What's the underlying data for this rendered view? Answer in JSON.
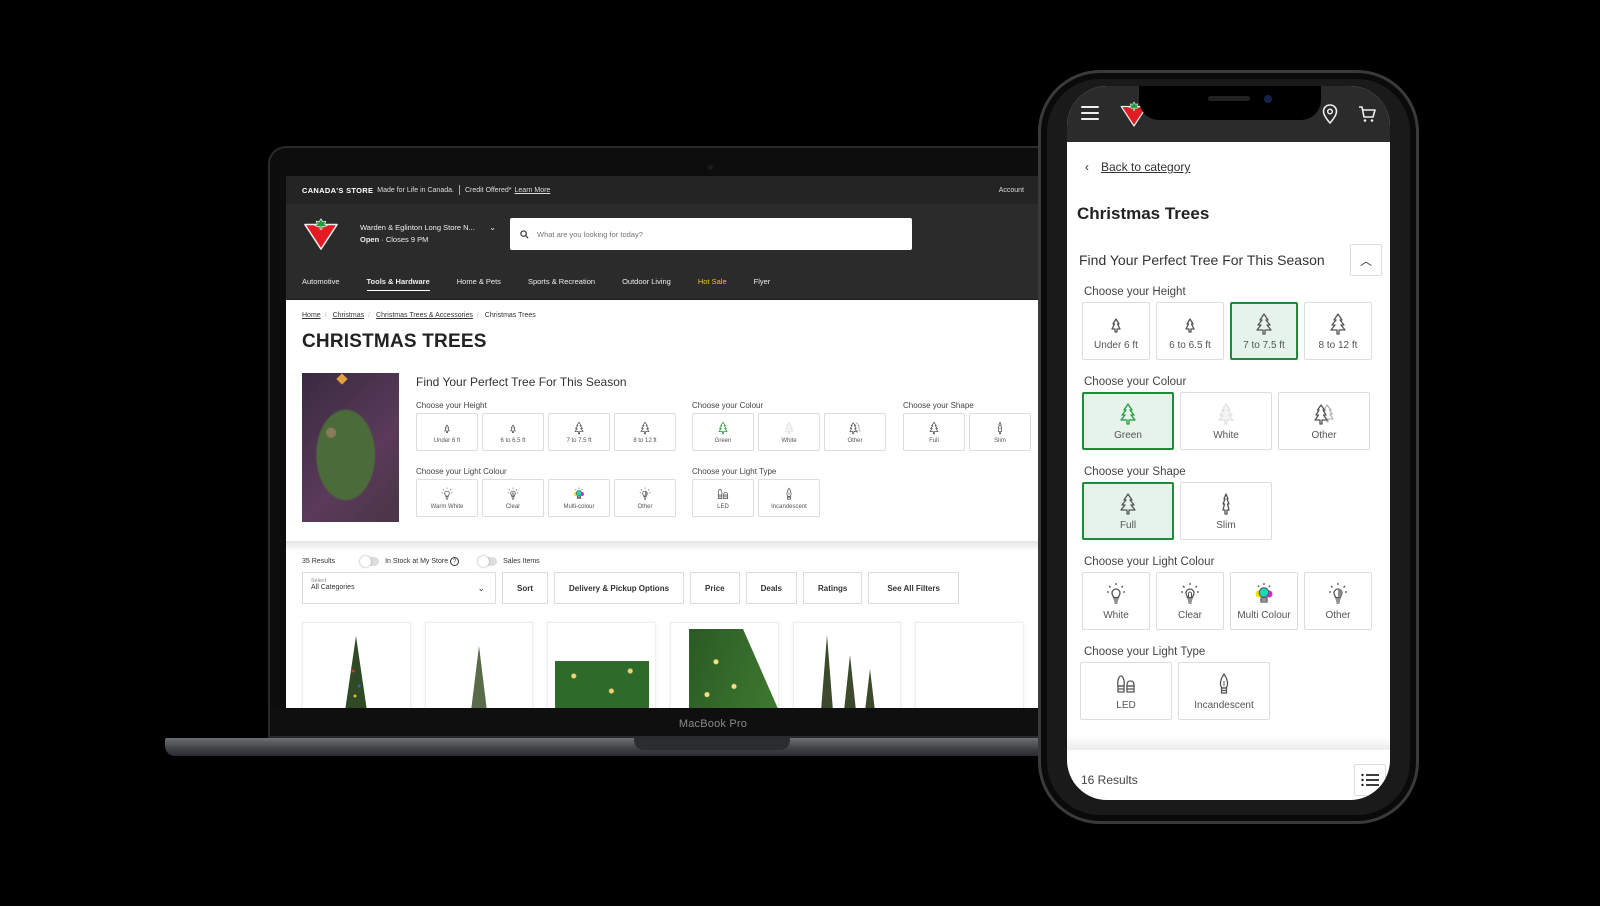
{
  "laptop": {
    "brand_label": "MacBook Pro",
    "utility_bar": {
      "brand": "CANADA'S STORE",
      "tagline": "Made for Life in Canada.",
      "credit": "Credit Offered*",
      "learn_more": "Learn More",
      "account": "Account"
    },
    "header": {
      "store_name": "Warden & Eglinton Long Store N...",
      "store_status": "Open",
      "store_hours": "· Closes 9 PM",
      "search_placeholder": "What are you looking for today?"
    },
    "nav": [
      {
        "label": "Automotive"
      },
      {
        "label": "Tools & Hardware",
        "active": true
      },
      {
        "label": "Home & Pets"
      },
      {
        "label": "Sports & Recreation"
      },
      {
        "label": "Outdoor Living"
      },
      {
        "label": "Hot Sale",
        "highlight": true
      },
      {
        "label": "Flyer"
      }
    ],
    "breadcrumb": [
      "Home",
      "Christmas",
      "Christmas Trees & Accessories",
      "Christmas Trees"
    ],
    "page_title": "CHRISTMAS TREES",
    "finder": {
      "title": "Find Your Perfect Tree For This Season",
      "height": {
        "label": "Choose your Height",
        "options": [
          "Under 6 ft",
          "6 to 6.5 ft",
          "7 to 7.5 ft",
          "8 to 12 ft"
        ]
      },
      "colour": {
        "label": "Choose your Colour",
        "options": [
          "Green",
          "White",
          "Other"
        ]
      },
      "shape": {
        "label": "Choose your Shape",
        "options": [
          "Full",
          "Slim"
        ]
      },
      "light_colour": {
        "label": "Choose your Light Colour",
        "options": [
          "Warm White",
          "Clear",
          "Multi-colour",
          "Other"
        ]
      },
      "light_type": {
        "label": "Choose your Light Type",
        "options": [
          "LED",
          "Incandescent"
        ]
      }
    },
    "results": {
      "count": "35 Results",
      "in_stock_label": "In Stock at My Store",
      "sales_label": "Sales Items",
      "in_stock_on": false,
      "sales_on": false
    },
    "filters": {
      "select_small": "Select",
      "select_value": "All Categories",
      "buttons": [
        "Sort",
        "Delivery & Pickup Options",
        "Price",
        "Deals",
        "Ratings",
        "See All Filters"
      ]
    }
  },
  "phone": {
    "back_link": "Back to category",
    "title": "Christmas Trees",
    "finder_title": "Find Your Perfect Tree For This Season",
    "height": {
      "label": "Choose your Height",
      "options": [
        "Under 6 ft",
        "6 to 6.5 ft",
        "7 to 7.5 ft",
        "8 to 12 ft"
      ],
      "selected": "7 to 7.5 ft"
    },
    "colour": {
      "label": "Choose your Colour",
      "options": [
        "Green",
        "White",
        "Other"
      ],
      "selected": "Green"
    },
    "shape": {
      "label": "Choose your Shape",
      "options": [
        "Full",
        "Slim"
      ],
      "selected": "Full"
    },
    "light_colour": {
      "label": "Choose your Light Colour",
      "options": [
        "White",
        "Clear",
        "Multi Colour",
        "Other"
      ]
    },
    "light_type": {
      "label": "Choose your Light Type",
      "options": [
        "LED",
        "Incandescent"
      ]
    },
    "results_count": "16 Results"
  },
  "colors": {
    "brand_red": "#e31b23",
    "maple_green": "#1f9d3a",
    "selected_green": "#1f8a3a",
    "selected_bg": "#e6f3ea",
    "hot_sale": "#f2c230",
    "header_dark": "#2b2b2b"
  }
}
